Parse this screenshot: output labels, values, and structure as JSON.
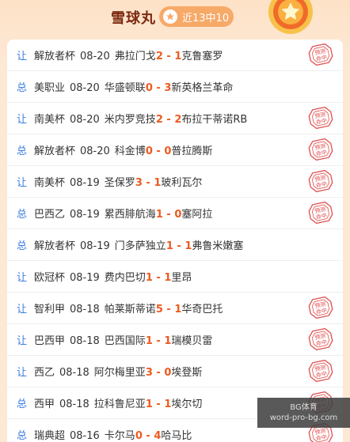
{
  "header": {
    "title": "雪球丸",
    "badge_text": "近13中10",
    "badge_icon": "star-icon",
    "accent": "#f7a968",
    "title_color": "#7a2a10"
  },
  "colors": {
    "type_label": "#3a7de0",
    "score": "#ee5a1f",
    "stamp": "#e05050"
  },
  "stamp_text": [
    "预测",
    "命中"
  ],
  "rows": [
    {
      "type": "让",
      "league": "解放者杯",
      "date": "08-20",
      "home": "弗拉门戈",
      "hs": "2",
      "as": "1",
      "away": "克鲁塞罗",
      "hit": true
    },
    {
      "type": "总",
      "league": "美职业",
      "date": "08-20",
      "home": "华盛顿联",
      "hs": "0",
      "as": "3",
      "away": "新英格兰革命",
      "hit": false
    },
    {
      "type": "让",
      "league": "南美杯",
      "date": "08-20",
      "home": "米内罗竞技",
      "hs": "2",
      "as": "2",
      "away": "布拉干蒂诺RB",
      "hit": true
    },
    {
      "type": "总",
      "league": "解放者杯",
      "date": "08-20",
      "home": "科金博",
      "hs": "0",
      "as": "0",
      "away": "普拉腾斯",
      "hit": true
    },
    {
      "type": "让",
      "league": "南美杯",
      "date": "08-19",
      "home": "圣保罗",
      "hs": "3",
      "as": "1",
      "away": "玻利瓦尔",
      "hit": true
    },
    {
      "type": "总",
      "league": "巴西乙",
      "date": "08-19",
      "home": "累西腓航海",
      "hs": "1",
      "as": "0",
      "away": "塞阿拉",
      "hit": true
    },
    {
      "type": "总",
      "league": "解放者杯",
      "date": "08-19",
      "home": "门多萨独立",
      "hs": "1",
      "as": "1",
      "away": "弗鲁米嫩塞",
      "hit": false
    },
    {
      "type": "让",
      "league": "欧冠杯",
      "date": "08-19",
      "home": "费内巴切",
      "hs": "1",
      "as": "1",
      "away": "里昂",
      "hit": false
    },
    {
      "type": "让",
      "league": "智利甲",
      "date": "08-18",
      "home": "帕莱斯蒂诺",
      "hs": "5",
      "as": "1",
      "away": "华奇巴托",
      "hit": true
    },
    {
      "type": "让",
      "league": "巴西甲",
      "date": "08-18",
      "home": "巴西国际",
      "hs": "1",
      "as": "1",
      "away": "瑞模贝雷",
      "hit": true
    },
    {
      "type": "让",
      "league": "西乙",
      "date": "08-18",
      "home": "阿尔梅里亚",
      "hs": "3",
      "as": "0",
      "away": "埃登斯",
      "hit": true
    },
    {
      "type": "总",
      "league": "西甲",
      "date": "08-18",
      "home": "拉科鲁尼亚",
      "hs": "1",
      "as": "1",
      "away": "埃尔切",
      "hit": true
    },
    {
      "type": "总",
      "league": "瑞典超",
      "date": "08-16",
      "home": "卡尔马",
      "hs": "0",
      "as": "4",
      "away": "哈马比",
      "hit": true
    }
  ],
  "watermark": {
    "line1": "BG体育",
    "line2": "word-pro-bg.com"
  }
}
